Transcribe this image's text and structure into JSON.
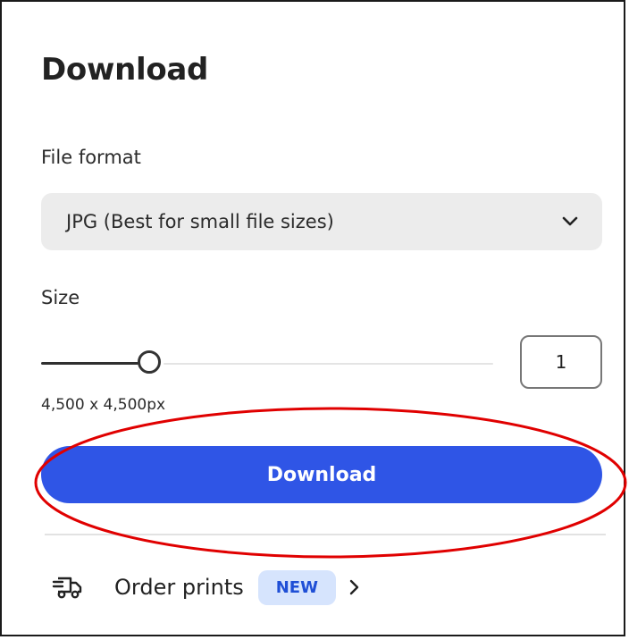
{
  "panel": {
    "title": "Download"
  },
  "file_format": {
    "label": "File format",
    "selected": "JPG (Best for small file sizes)",
    "dropdown_icon": "chevron-down-icon"
  },
  "size": {
    "label": "Size",
    "slider_level_fraction": 0.24,
    "multiplier_value": "1",
    "dimensions": "4,500 x 4,500px"
  },
  "actions": {
    "download_label": "Download",
    "annotation_color": "#e00000",
    "button_color": "#2f55e6"
  },
  "order_prints": {
    "icon": "truck-icon",
    "label": "Order prints",
    "badge": "NEW",
    "arrow_icon": "chevron-right-icon"
  }
}
